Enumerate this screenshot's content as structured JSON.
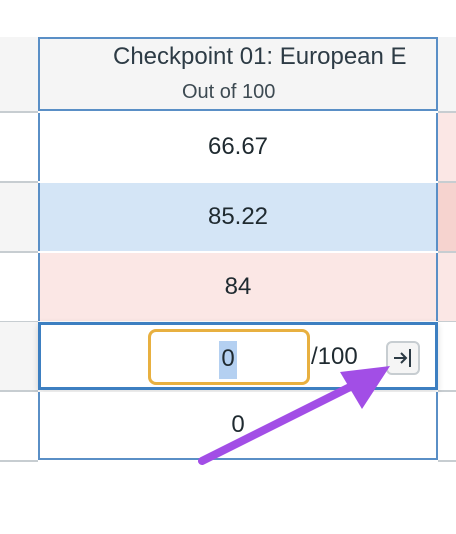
{
  "header": {
    "title": "Checkpoint 01: European E",
    "subtitle": "Out of 100"
  },
  "rows": [
    {
      "score": "66.67"
    },
    {
      "score": "85.22"
    },
    {
      "score": "84"
    }
  ],
  "editing_row": {
    "input_value": "0",
    "out_of": "/100",
    "submit_icon": "enter-arrow-icon"
  },
  "last_row": {
    "score": "0"
  },
  "colors": {
    "header_border": "#5a8fc6",
    "row_blue": "#d4e5f6",
    "row_pink": "#fbe7e5",
    "input_focus": "#e8b040",
    "annotation_arrow": "#a24ee6"
  }
}
